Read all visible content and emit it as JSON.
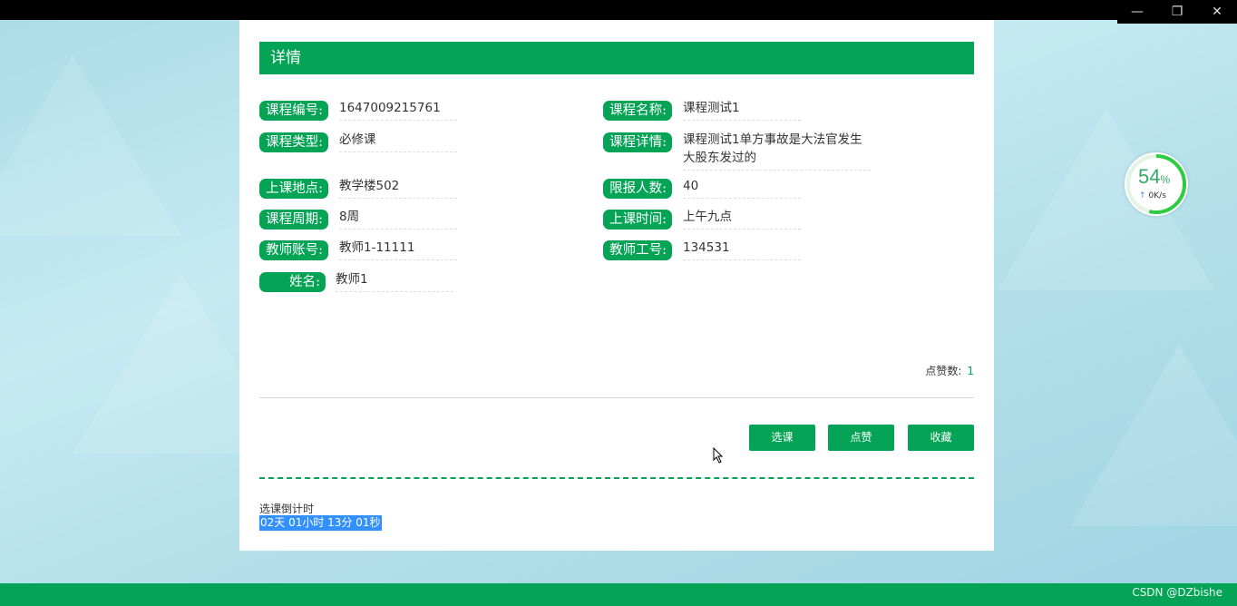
{
  "detail": {
    "title": "详情",
    "fields": {
      "course_no": {
        "label": "课程编号:",
        "value": "1647009215761"
      },
      "course_name": {
        "label": "课程名称:",
        "value": "课程测试1"
      },
      "course_type": {
        "label": "课程类型:",
        "value": "必修课"
      },
      "course_detail": {
        "label": "课程详情:",
        "value": "课程测试1单方事故是大法官发生大股东发过的"
      },
      "location": {
        "label": "上课地点:",
        "value": "教学楼502"
      },
      "limit": {
        "label": "限报人数:",
        "value": "40"
      },
      "period": {
        "label": "课程周期:",
        "value": "8周"
      },
      "time": {
        "label": "上课时间:",
        "value": "上午九点"
      },
      "teacher_acct": {
        "label": "教师账号:",
        "value": "教师1-11111"
      },
      "teacher_no": {
        "label": "教师工号:",
        "value": "134531"
      },
      "name": {
        "label": "姓名:",
        "value": "教师1"
      }
    },
    "likes_label": "点赞数:",
    "likes_count": "1",
    "buttons": {
      "select": "选课",
      "like": "点赞",
      "favorite": "收藏"
    },
    "countdown_label": "选课倒计时",
    "countdown_value": "02天 01小时 13分 01秒"
  },
  "speed_widget": {
    "percent": "54",
    "percent_sign": "%",
    "rate": "0K/s"
  },
  "footer": {
    "watermark": "CSDN @DZbishe"
  },
  "colors": {
    "accent": "#05a356",
    "selection": "#3390ff"
  },
  "window_controls": [
    "minimize-icon",
    "restore-icon",
    "close-icon"
  ]
}
